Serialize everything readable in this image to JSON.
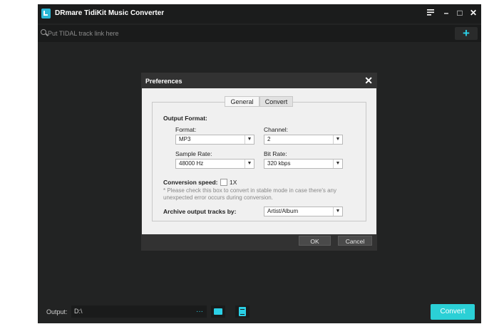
{
  "app": {
    "title": "DRmare TidiKit Music Converter",
    "accent_color": "#2bd0d6"
  },
  "search": {
    "placeholder": "Put TIDAL track link here"
  },
  "window_controls": {
    "menu_icon": "menu-icon",
    "minimize": "–",
    "maximize": "□",
    "close": "✕"
  },
  "add_button_label": "+",
  "output": {
    "label": "Output:",
    "path": "D:\\",
    "browse_label": "···",
    "convert_label": "Convert"
  },
  "preferences": {
    "title": "Preferences",
    "close": "✕",
    "tabs": [
      {
        "label": "General",
        "active": false
      },
      {
        "label": "Convert",
        "active": true
      }
    ],
    "output_format_label": "Output Format:",
    "format": {
      "label": "Format:",
      "value": "MP3"
    },
    "channel": {
      "label": "Channel:",
      "value": "2"
    },
    "sample_rate": {
      "label": "Sample Rate:",
      "value": "48000 Hz"
    },
    "bit_rate": {
      "label": "Bit Rate:",
      "value": "320 kbps"
    },
    "conversion_speed": {
      "label": "Conversion speed:",
      "checkbox_label": "1X",
      "checked": false,
      "note": "* Please check this box to convert in stable mode in case there's any unexpected error occurs during conversion."
    },
    "archive": {
      "label": "Archive output tracks by:",
      "value": "Artist/Album"
    },
    "ok_label": "OK",
    "cancel_label": "Cancel"
  }
}
